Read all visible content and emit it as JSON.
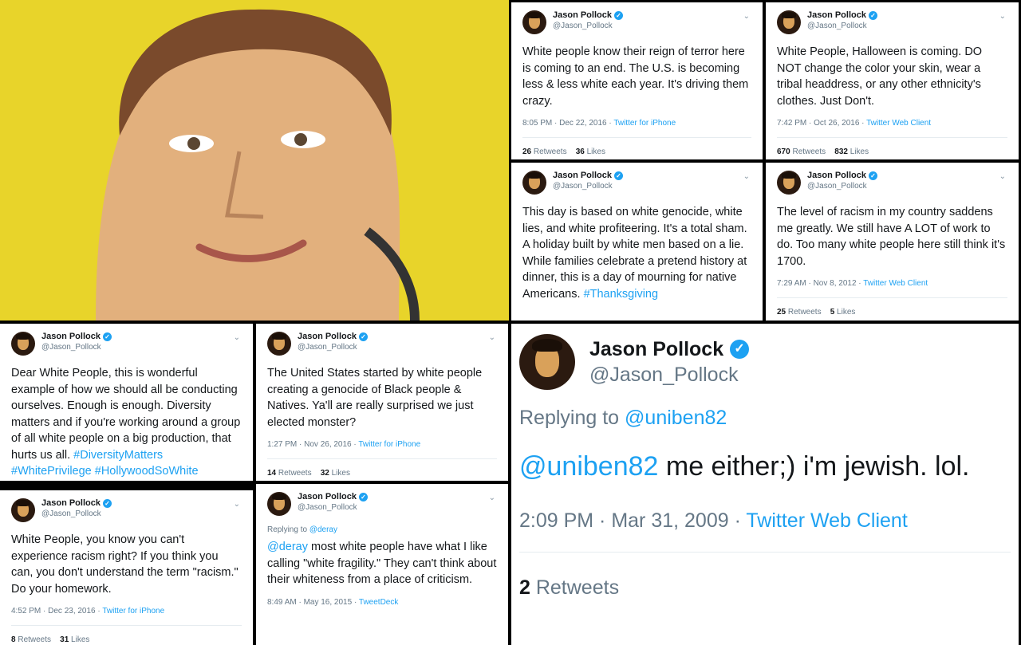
{
  "author": {
    "name": "Jason Pollock",
    "handle": "@Jason_Pollock",
    "verified_badge": "✓"
  },
  "colors": {
    "link": "#1da1f2",
    "photo_background": "#e8d42a"
  },
  "icons": {
    "verified": "verified-badge-icon",
    "more": "chevron-down-icon"
  },
  "tweets": [
    {
      "text": "White people know their reign of terror here is coming to an end. The U.S. is becoming less & less white each year. It's driving them crazy.",
      "time": "8:05 PM · Dec 22, 2016 · ",
      "source": "Twitter for iPhone",
      "retweets": "26",
      "retweets_label": " Retweets",
      "likes": "36",
      "likes_label": " Likes"
    },
    {
      "text": "White People, Halloween is coming. DO NOT change the color your skin, wear a tribal headdress, or any other ethnicity's clothes. Just Don't.",
      "time": "7:42 PM · Oct 26, 2016 · ",
      "source": "Twitter Web Client",
      "retweets": "670",
      "retweets_label": " Retweets",
      "likes": "832",
      "likes_label": " Likes"
    },
    {
      "text": "This day is based on white genocide, white lies, and white profiteering. It's a total sham. A holiday built by white men based on a lie. While families celebrate a pretend history at dinner, this is a day of mourning for native Americans. ",
      "hashtag": "#Thanksgiving"
    },
    {
      "text": "The level of racism in my country saddens me greatly. We still have A LOT of work to do. Too many white people here still think it's 1700.",
      "time": "7:29 AM · Nov 8, 2012 · ",
      "source": "Twitter Web Client",
      "retweets": "25",
      "retweets_label": " Retweets",
      "likes": "5",
      "likes_label": " Likes"
    },
    {
      "text": "Dear White People, this is wonderful example of how we should all be conducting ourselves. Enough is enough. Diversity matters and if you're working around a group of all white people on a big production, that hurts us all. ",
      "hashtags": "#DiversityMatters #WhitePrivilege #HollywoodSoWhite"
    },
    {
      "text": "The United States started by white people creating a genocide of Black people & Natives. Ya'll are really surprised we just elected monster?",
      "time": "1:27 PM · Nov 26, 2016 · ",
      "source": "Twitter for iPhone",
      "retweets": "14",
      "retweets_label": " Retweets",
      "likes": "32",
      "likes_label": " Likes"
    },
    {
      "text": "White People, you know you can't experience racism right? If you think you can, you don't understand the term \"racism.\" Do your homework.",
      "time": "4:52 PM · Dec 23, 2016 · ",
      "source": "Twitter for iPhone",
      "retweets": "8",
      "retweets_label": " Retweets",
      "likes": "31",
      "likes_label": " Likes"
    },
    {
      "reply_prefix": "Replying to ",
      "reply_to": "@deray",
      "mention": "@deray",
      "text": " most white people have what I like calling \"white fragility.\" They can't think about their whiteness from a place of criticism.",
      "time": "8:49 AM · May 16, 2015 · ",
      "source": "TweetDeck"
    }
  ],
  "big_tweet": {
    "reply_prefix": "Replying to ",
    "reply_to": "@uniben82",
    "mention": "@uniben82",
    "text": " me either;) i'm jewish. lol.",
    "time": "2:09 PM · Mar 31, 2009 · ",
    "source": "Twitter Web Client",
    "retweets": "2",
    "retweets_label": " Retweets"
  }
}
